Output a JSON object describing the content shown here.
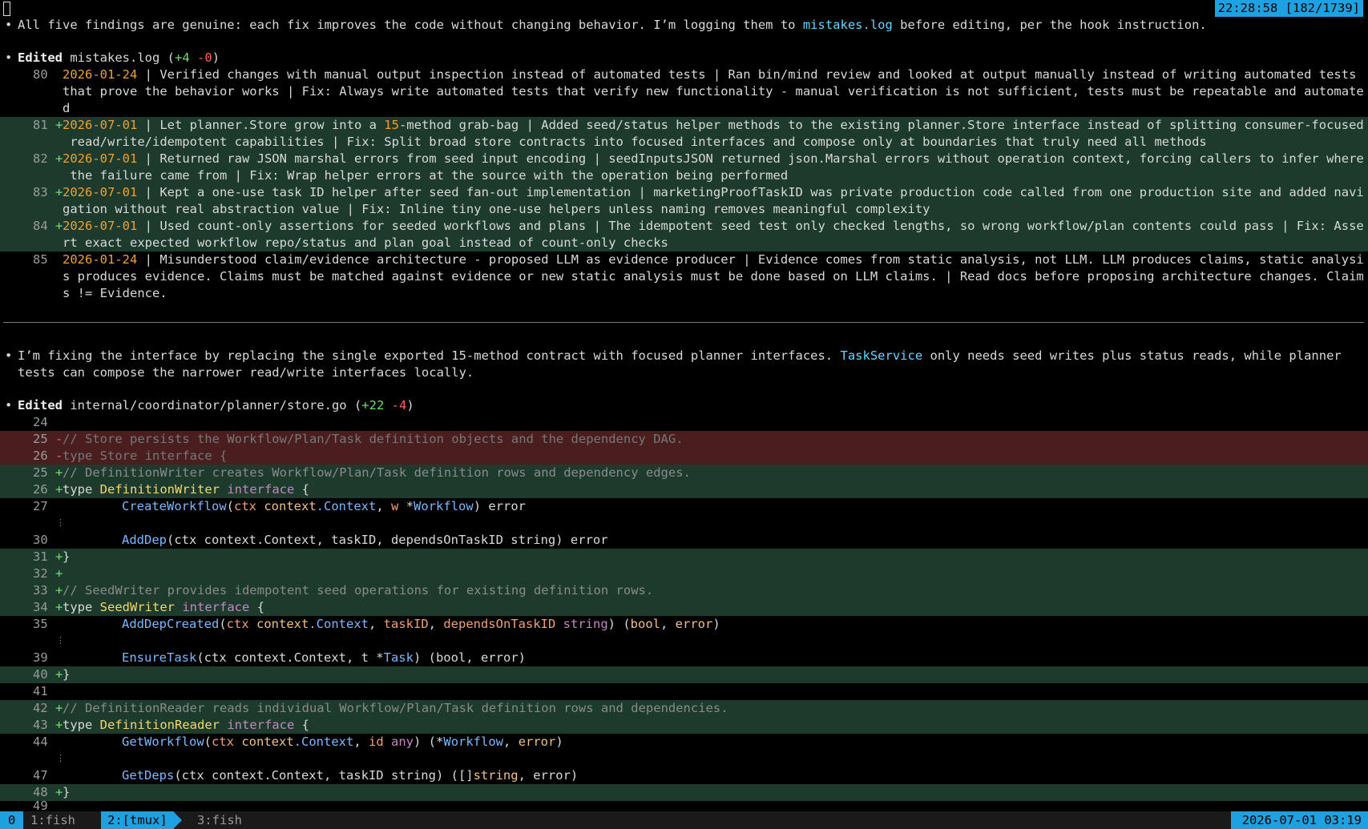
{
  "header": {
    "clock": "22:28:58 [182/1739]"
  },
  "message1": {
    "bullet": "•",
    "pre": "All five findings are genuine: each fix improves the code without changing behavior. I’m logging them to ",
    "file": "mistakes.log",
    "post": " before editing, per the hook instruction."
  },
  "edit1": {
    "bullet": "•",
    "verb": "Edited",
    "file": "mistakes.log",
    "open": " (",
    "added": "+4",
    "removed": "-0",
    "close": ")",
    "lines": [
      {
        "num": "80",
        "sign": " ",
        "date": "2026-01-24",
        "text": " | Verified changes with manual output inspection instead of automated tests | Ran bin/mind review and looked at output manually instead of writing automated tests"
      },
      {
        "num": "",
        "sign": " ",
        "date": "",
        "text": "that prove the behavior works | Fix: Always write automated tests that verify new functionality - manual verification is not sufficient, tests must be repeatable and automate"
      },
      {
        "num": "",
        "sign": " ",
        "date": "",
        "text": "d"
      },
      {
        "num": "81",
        "sign": "+",
        "date": "2026-07-01",
        "text": " | Let planner.Store grow into a ",
        "hl": "15",
        "text2": "-method grab-bag | Added seed/status helper methods to the existing planner.Store interface instead of splitting consumer-focused"
      },
      {
        "num": "",
        "sign": " ",
        "date": "",
        "text": " read/write/idempotent capabilities | Fix: Split broad store contracts into focused interfaces and compose only at boundaries that truly need all methods"
      },
      {
        "num": "82",
        "sign": "+",
        "date": "2026-07-01",
        "text": " | Returned raw JSON marshal errors from seed input encoding | seedInputsJSON returned json.Marshal errors without operation context, forcing callers to infer where"
      },
      {
        "num": "",
        "sign": " ",
        "date": "",
        "text": " the failure came from | Fix: Wrap helper errors at the source with the operation being performed"
      },
      {
        "num": "83",
        "sign": "+",
        "date": "2026-07-01",
        "text": " | Kept a one-use task ID helper after seed fan-out implementation | marketingProofTaskID was private production code called from one production site and added navi"
      },
      {
        "num": "",
        "sign": " ",
        "date": "",
        "text": "gation without real abstraction value | Fix: Inline tiny one-use helpers unless naming removes meaningful complexity"
      },
      {
        "num": "84",
        "sign": "+",
        "date": "2026-07-01",
        "text": " | Used count-only assertions for seeded workflows and plans | The idempotent seed test only checked lengths, so wrong workflow/plan contents could pass | Fix: Asse"
      },
      {
        "num": "",
        "sign": " ",
        "date": "",
        "text": "rt exact expected workflow repo/status and plan goal instead of count-only checks"
      },
      {
        "num": "85",
        "sign": " ",
        "date": "2026-01-24",
        "text": " | Misunderstood claim/evidence architecture - proposed LLM as evidence producer | Evidence comes from static analysis, not LLM. LLM produces claims, static analysi"
      },
      {
        "num": "",
        "sign": " ",
        "date": "",
        "text": "s produces evidence. Claims must be matched against evidence or new static analysis must be done based on LLM claims. | Read docs before proposing architecture changes. Claim"
      },
      {
        "num": "",
        "sign": " ",
        "date": "",
        "text": "s != Evidence."
      }
    ]
  },
  "message2": {
    "bullet": "•",
    "pre": "I’m fixing the interface by replacing the single exported 15-method contract with focused planner interfaces. ",
    "ident": "TaskService",
    "post": " only needs seed writes plus status reads, while planner",
    "line2": "tests can compose the narrower read/write interfaces locally."
  },
  "edit2": {
    "bullet": "•",
    "verb": "Edited",
    "file": "internal/coordinator/planner/store.go",
    "open": " (",
    "added": "+22",
    "removed": "-4",
    "close": ")"
  },
  "code": {
    "ln24": "24",
    "ln25d": "25",
    "sign25d": "-",
    "c25d": "// Store persists the Workflow/Plan/Task definition objects and the dependency DAG.",
    "ln26d": "26",
    "sign26d": "-",
    "k26d": "type",
    "t26d": "Store",
    "i26d": "interface",
    "b26d": "{",
    "ln25a": "25",
    "sign25a": "+",
    "c25a": "// DefinitionWriter creates Workflow/Plan/Task definition rows and dependency edges.",
    "ln26a": "26",
    "sign26a": "+",
    "k26a": "type",
    "t26a": "DefinitionWriter",
    "i26a": "interface",
    "b26a": "{",
    "ln27": "27",
    "f27": "CreateWorkflow",
    "p27a": "ctx",
    "pk27": "context",
    "ty27": ".Context",
    "p27b": "w",
    "st27": "*",
    "ty27b": "Workflow",
    "r27": "error",
    "dots1": "⋮",
    "ln30": "30",
    "f30": "AddDep",
    "a30": "(ctx context.Context, taskID, dependsOnTaskID string) error",
    "ln31": "31",
    "sign31": "+",
    "b31": "}",
    "ln32": "32",
    "sign32": "+",
    "ln33": "33",
    "sign33": "+",
    "c33": "// SeedWriter provides idempotent seed operations for existing definition rows.",
    "ln34": "34",
    "sign34": "+",
    "k34": "type",
    "t34": "SeedWriter",
    "i34": "interface",
    "b34": "{",
    "ln35": "35",
    "f35": "AddDepCreated",
    "p35a": "ctx",
    "pk35": "context",
    "ty35": ".Context",
    "p35b": "taskID",
    "p35c": "dependsOnTaskID",
    "k35": "string",
    "r35a": "bool",
    "r35b": "error",
    "dots2": "⋮",
    "ln39": "39",
    "f39": "EnsureTask",
    "a39": "(ctx context.Context, t ",
    "st39": "*",
    "ty39": "Task",
    "r39": ") (bool, error)",
    "ln40": "40",
    "sign40": "+",
    "b40": "}",
    "ln41": "41",
    "ln42": "42",
    "sign42": "+",
    "c42": "// DefinitionReader reads individual Workflow/Plan/Task definition rows and dependencies.",
    "ln43": "43",
    "sign43": "+",
    "k43": "type",
    "t43": "DefinitionReader",
    "i43": "interface",
    "b43": "{",
    "ln44": "44",
    "f44": "GetWorkflow",
    "p44a": "ctx",
    "pk44": "context",
    "ty44": ".Context",
    "p44b": "id",
    "k44": "any",
    "st44": "*",
    "ty44b": "Workflow",
    "r44": "error",
    "dots3": "⋮",
    "ln47": "47",
    "f47": "GetDeps",
    "a47": "(ctx context.Context, taskID string) (",
    "br47": "[]",
    "ty47": "string",
    "r47": ", error)",
    "ln48": "48",
    "sign48": "+",
    "b48": "}",
    "ln49": "49"
  },
  "statusbar": {
    "session": "0",
    "win1": "1:fish",
    "win2": "2:[tmux]",
    "win3": "3:fish",
    "datetime": "2026-07-01 03:19"
  }
}
